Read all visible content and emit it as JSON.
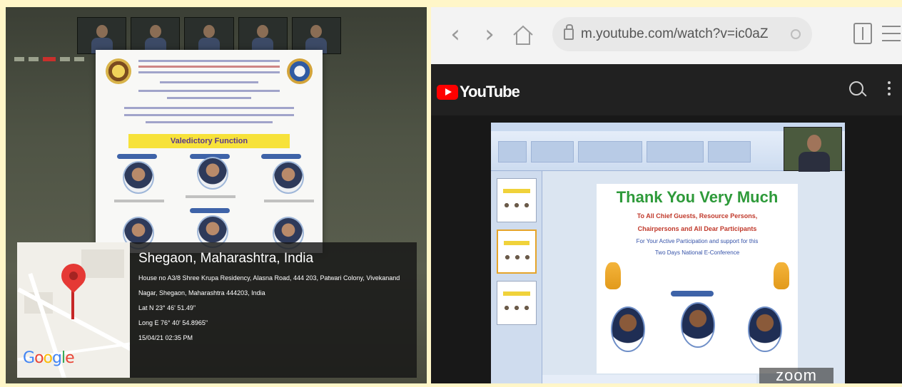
{
  "geotag": {
    "place": "Shegaon, Maharashtra, India",
    "address": "House no A3/8 Shree Krupa Residency, Alasna Road, 444 203, Patwari Colony, Vivekanand Nagar, Shegaon, Maharashtra 444203, India",
    "lat": "Lat N 23° 46' 51.49\"",
    "long": "Long E 76° 40' 54.8965\"",
    "datetime": "15/04/21 02:35 PM",
    "map_brand": "Google"
  },
  "poster": {
    "banner": "Valedictory Function"
  },
  "browser": {
    "url": "m.youtube.com/watch?v=ic0aZ",
    "back_icon": "back-arrow-icon",
    "forward_icon": "forward-arrow-icon"
  },
  "youtube": {
    "brand": "YouTube",
    "slide": {
      "title": "Thank You Very Much",
      "line1": "To All Chief Guests, Resource Persons,",
      "line2": "Chairpersons and All Dear Participants",
      "line3": "For Your Active Participation and support for this",
      "line4": "Two Days National E-Conference"
    },
    "watermark": "zoom"
  },
  "colors": {
    "page_bg": "#fff6c8",
    "youtube_red": "#ff0000",
    "slide_title_green": "#2e9a3a",
    "banner_yellow": "#f7e23a"
  }
}
